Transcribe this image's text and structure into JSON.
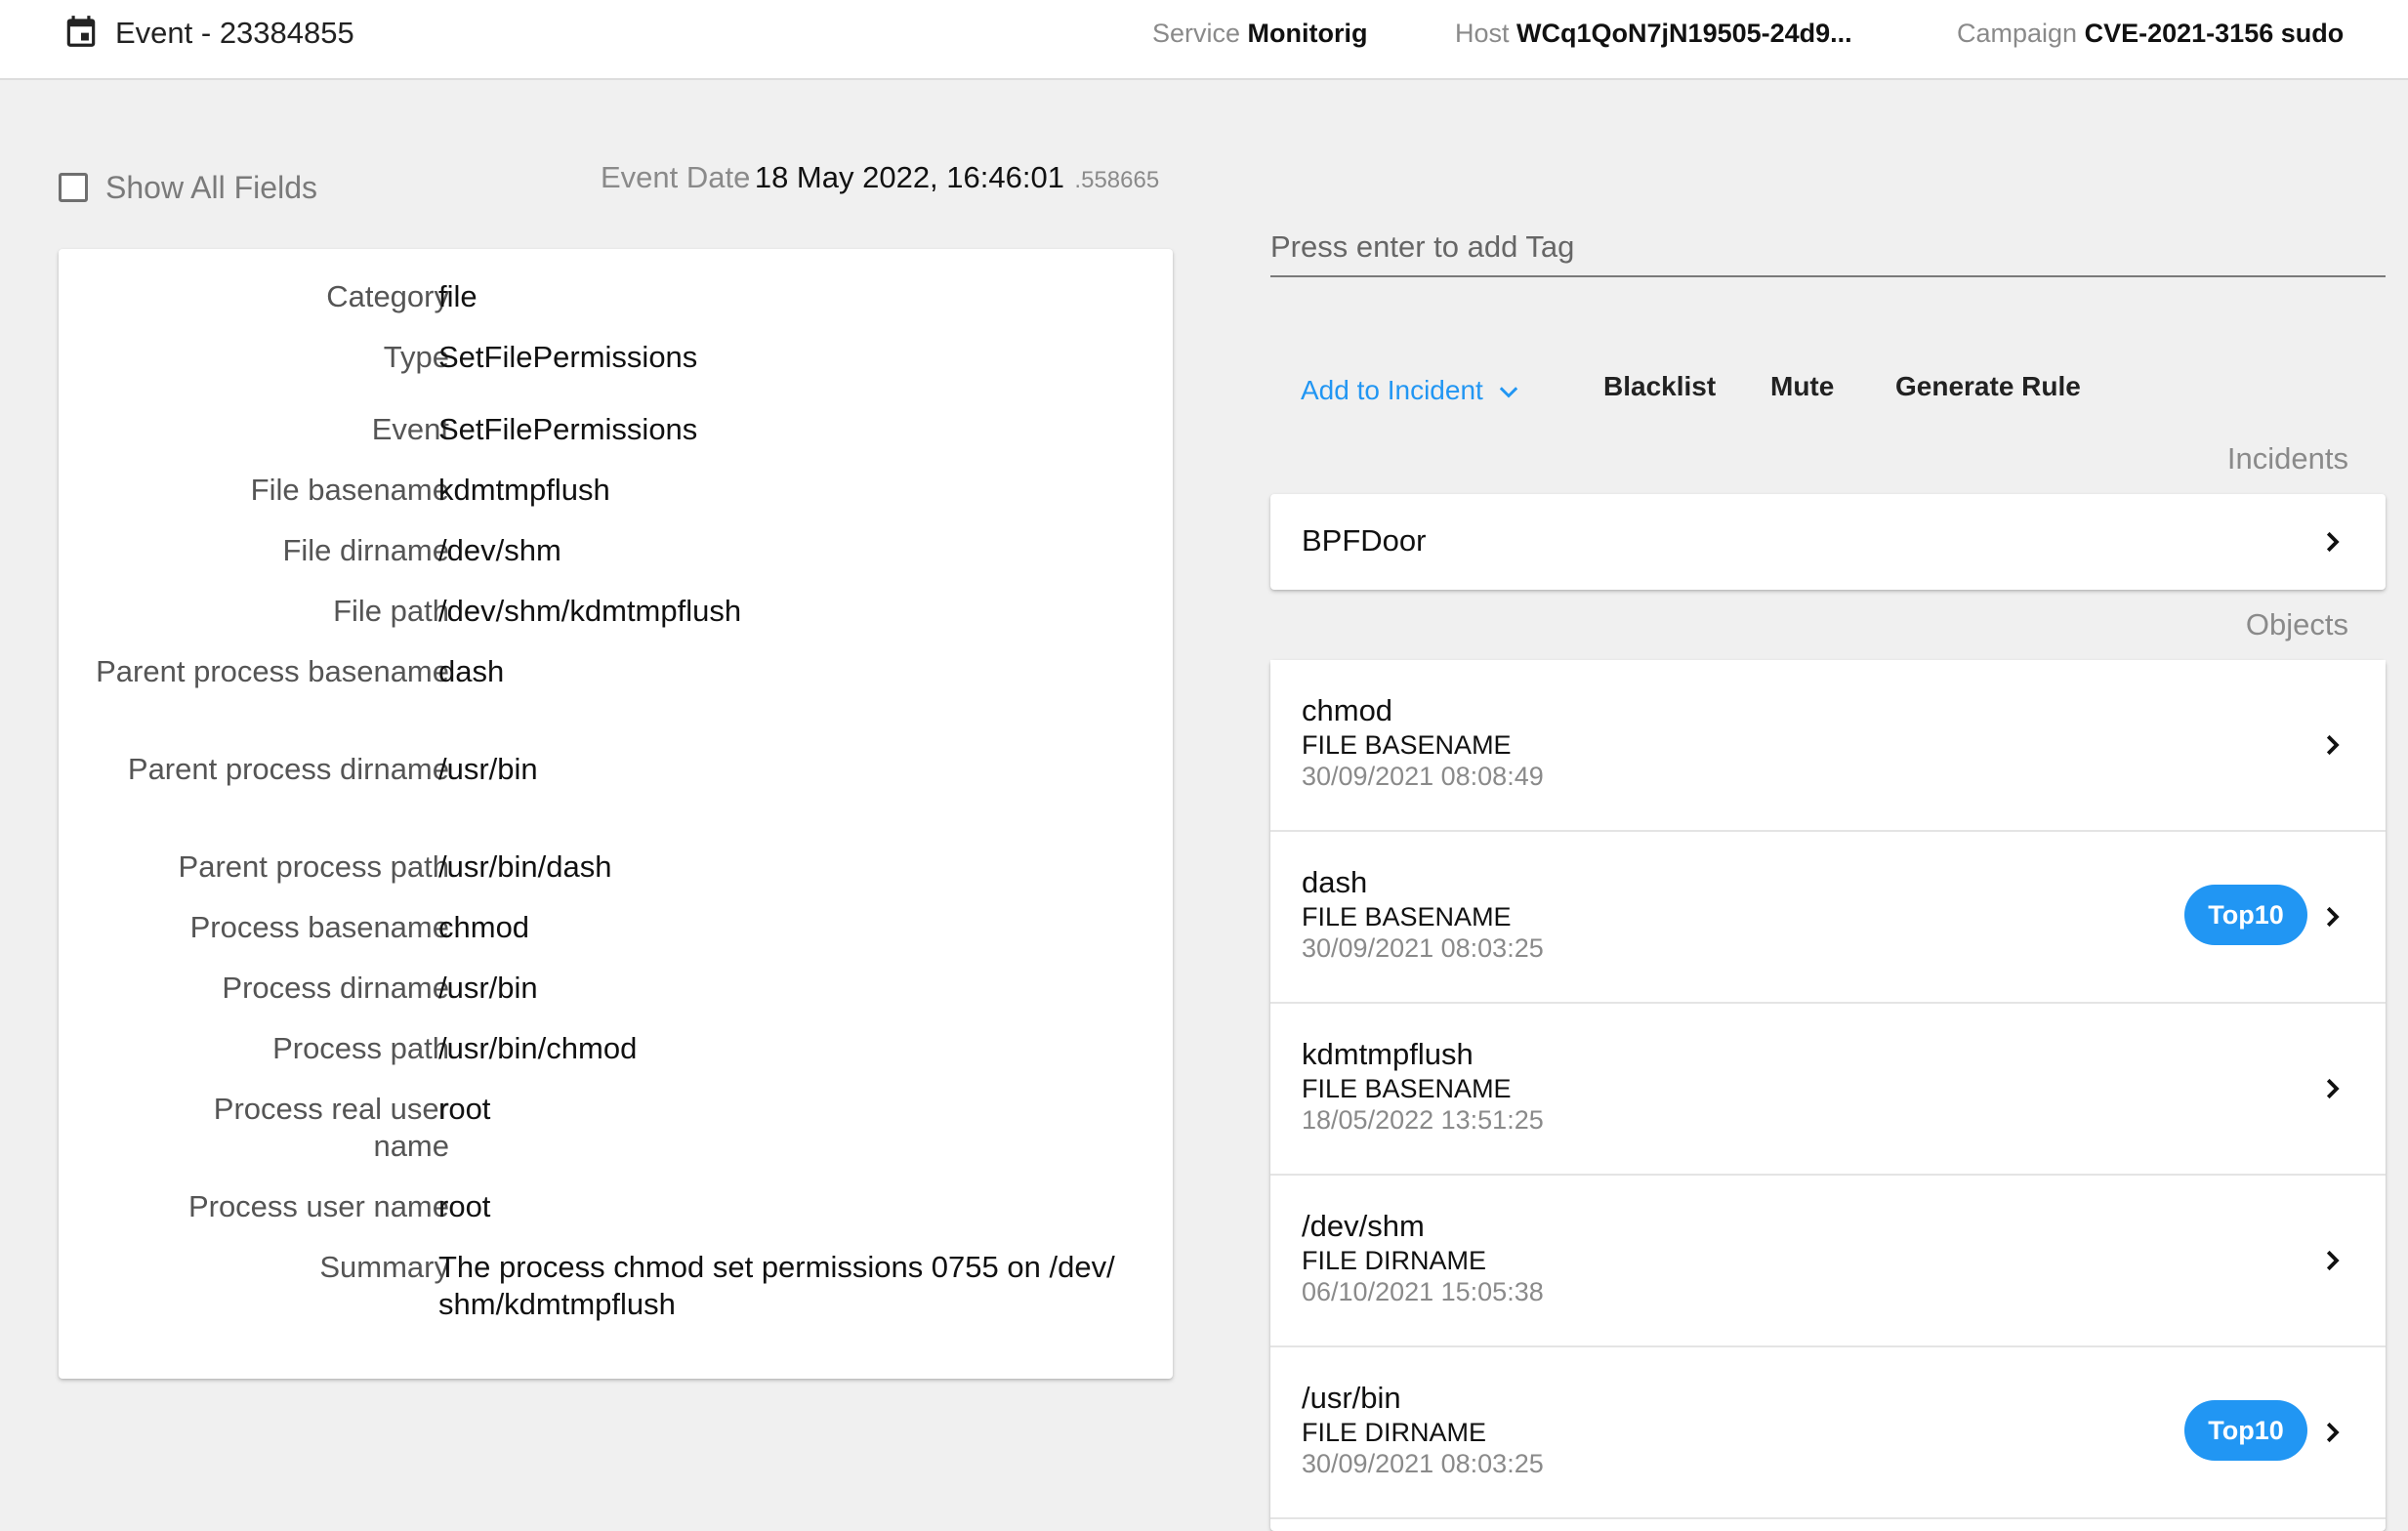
{
  "header": {
    "title": "Event - 23384855",
    "service_key": "Service",
    "service_value": "Monitorig",
    "host_key": "Host",
    "host_value": "WCq1QoN7jN19505-24d9...",
    "campaign_key": "Campaign",
    "campaign_value": "CVE-2021-3156 sudo"
  },
  "toolbar": {
    "show_all_label": "Show All Fields",
    "event_date_key": "Event Date",
    "event_date_value": "18 May 2022, 16:46:01",
    "event_date_ms": ".558665"
  },
  "details": [
    {
      "label": "Category",
      "value": "file"
    },
    {
      "label": "Type",
      "value": "SetFilePermissions"
    },
    {
      "label": "Event",
      "value": "SetFilePermissions"
    },
    {
      "label": "File basename",
      "value": "kdmtmpflush"
    },
    {
      "label": "File dirname",
      "value": "/dev/shm"
    },
    {
      "label": "File path",
      "value": "/dev/shm/kdmtmpflush"
    },
    {
      "label": "Parent process basename",
      "value": "dash"
    },
    {
      "label": "Parent process dirname",
      "value": "/usr/bin"
    },
    {
      "label": "Parent process path",
      "value": "/usr/bin/dash"
    },
    {
      "label": "Process basename",
      "value": "chmod"
    },
    {
      "label": "Process dirname",
      "value": "/usr/bin"
    },
    {
      "label": "Process path",
      "value": "/usr/bin/chmod"
    },
    {
      "label": "Process real user name",
      "value": "root"
    },
    {
      "label": "Process user name",
      "value": "root"
    },
    {
      "label": "Summary",
      "value": "The process chmod set permissions 0755 on /dev/shm/kdmtmpflush"
    }
  ],
  "tag_input": {
    "placeholder": "Press enter to add Tag",
    "value": ""
  },
  "actions": {
    "add_to_incident": "Add to Incident",
    "blacklist": "Blacklist",
    "mute": "Mute",
    "generate_rule": "Generate Rule"
  },
  "incidents": {
    "section_label": "Incidents",
    "items": [
      {
        "name": "BPFDoor"
      }
    ]
  },
  "objects": {
    "section_label": "Objects",
    "items": [
      {
        "name": "chmod",
        "type": "FILE BASENAME",
        "date": "30/09/2021 08:08:49",
        "badge": ""
      },
      {
        "name": "dash",
        "type": "FILE BASENAME",
        "date": "30/09/2021 08:03:25",
        "badge": "Top10"
      },
      {
        "name": "kdmtmpflush",
        "type": "FILE BASENAME",
        "date": "18/05/2022 13:51:25",
        "badge": ""
      },
      {
        "name": "/dev/shm",
        "type": "FILE DIRNAME",
        "date": "06/10/2021 15:05:38",
        "badge": ""
      },
      {
        "name": "/usr/bin",
        "type": "FILE DIRNAME",
        "date": "30/09/2021 08:03:25",
        "badge": "Top10"
      }
    ]
  },
  "colors": {
    "accent": "#2196f3",
    "background": "#f0f0f0",
    "card": "#ffffff"
  },
  "icons": {
    "calendar": "calendar-icon",
    "chevron_down": "chevron-down-icon",
    "chevron_right": "chevron-right-icon"
  }
}
